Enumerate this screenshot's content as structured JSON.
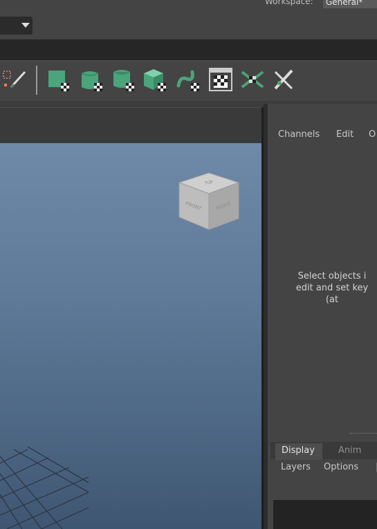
{
  "topbar": {
    "workspace_label": "Workspace:",
    "workspace_value": "General*"
  },
  "shelf": {
    "icons": [
      "paint-select-icon",
      "nurbs-square-icon",
      "nurbs-cylinder-icon",
      "nurbs-cone-icon",
      "nurbs-cube-icon",
      "nurbs-curve-icon",
      "uv-checker-icon",
      "xray-icon",
      "tool-pen-icon"
    ],
    "accent": "#4aa47c"
  },
  "channel_box": {
    "menu": [
      "Channels",
      "Edit",
      "O"
    ],
    "message_lines": [
      "Select objects i",
      "edit and set key",
      "(at"
    ]
  },
  "layer_editor": {
    "tabs": [
      "Display",
      "Anim"
    ],
    "menu": [
      "Layers",
      "Options",
      "|"
    ]
  },
  "view_cube": {
    "face_front": "FRONT",
    "face_right": "RIGHT",
    "face_top": "TOP"
  }
}
